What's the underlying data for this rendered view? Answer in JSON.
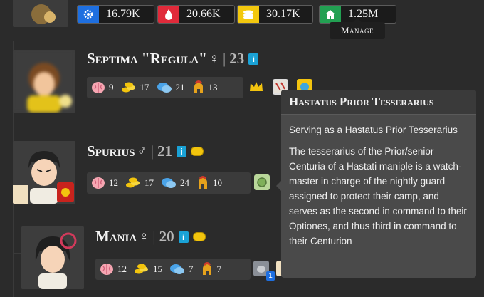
{
  "stats": [
    {
      "icon": "gear-icon",
      "value": "16.79K",
      "color": "#1e6fe0"
    },
    {
      "icon": "blood-drop-icon",
      "value": "20.66K",
      "color": "#e02a3a"
    },
    {
      "icon": "coins-icon",
      "value": "30.17K",
      "color": "#f3c80e"
    },
    {
      "icon": "home-icon",
      "value": "1.25M",
      "color": "#22a052"
    }
  ],
  "manage_tooltip": "Manage",
  "characters": [
    {
      "name": "Septima \"Regula\"",
      "gender": "♀",
      "sep": "|",
      "age": "23",
      "info": "i",
      "attrs": [
        {
          "icon": "brain-icon",
          "value": "9"
        },
        {
          "icon": "coins-icon",
          "value": "17"
        },
        {
          "icon": "speech-icon",
          "value": "21"
        },
        {
          "icon": "helmet-icon",
          "value": "13"
        }
      ]
    },
    {
      "name": "Spurius",
      "gender": "♂",
      "sep": "|",
      "age": "21",
      "info": "i",
      "attrs": [
        {
          "icon": "brain-icon",
          "value": "12"
        },
        {
          "icon": "coins-icon",
          "value": "17"
        },
        {
          "icon": "speech-icon",
          "value": "24"
        },
        {
          "icon": "helmet-icon",
          "value": "10"
        }
      ]
    },
    {
      "name": "Mania",
      "gender": "♀",
      "sep": "|",
      "age": "20",
      "info": "i",
      "attrs": [
        {
          "icon": "brain-icon",
          "value": "12"
        },
        {
          "icon": "coins-icon",
          "value": "15"
        },
        {
          "icon": "speech-icon",
          "value": "7"
        },
        {
          "icon": "helmet-icon",
          "value": "7"
        }
      ]
    }
  ],
  "mania_badge_count": "1",
  "tooltip": {
    "title": "Hastatus Prior Tesserarius",
    "p1": "Serving as a Hastatus Prior Tesserarius",
    "p2": "The tesserarius of the Prior/senior Centuria of a Hastati maniple is a watch-master in charge of the nightly guard assigned to protect their camp, and serves as the second in command to their Optiones, and thus third in command to their Centurion"
  }
}
